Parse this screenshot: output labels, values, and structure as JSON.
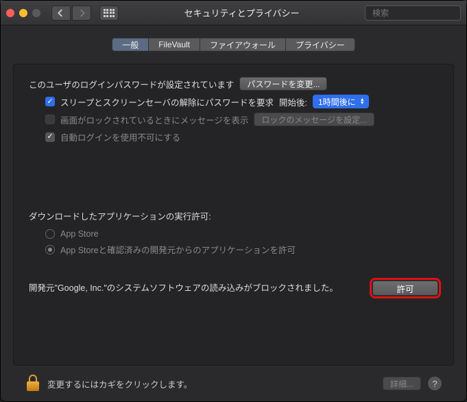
{
  "window": {
    "title": "セキュリティとプライバシー"
  },
  "search": {
    "placeholder": "検索",
    "value": ""
  },
  "tabs": {
    "general": "一般",
    "filevault": "FileVault",
    "firewall": "ファイアウォール",
    "privacy": "プライバシー"
  },
  "login": {
    "status": "このユーザのログインパスワードが設定されています",
    "change_btn": "パスワードを変更...",
    "require_pw": "スリープとスクリーンセーバの解除にパスワードを要求",
    "begins_label": "開始後:",
    "begins_value": "1時間後に",
    "lock_message": "画面がロックされているときにメッセージを表示",
    "lock_msg_btn": "ロックのメッセージを設定...",
    "disable_autologin": "自動ログインを使用不可にする"
  },
  "downloads": {
    "title": "ダウンロードしたアプリケーションの実行許可:",
    "opt_appstore": "App Store",
    "opt_identified": "App Storeと確認済みの開発元からのアプリケーションを許可"
  },
  "blocked": {
    "text": "開発元\"Google, Inc.\"のシステムソフトウェアの読み込みがブロックされました。",
    "allow": "許可"
  },
  "footer": {
    "text": "変更するにはカギをクリックします。",
    "details": "詳細...",
    "help": "?"
  }
}
